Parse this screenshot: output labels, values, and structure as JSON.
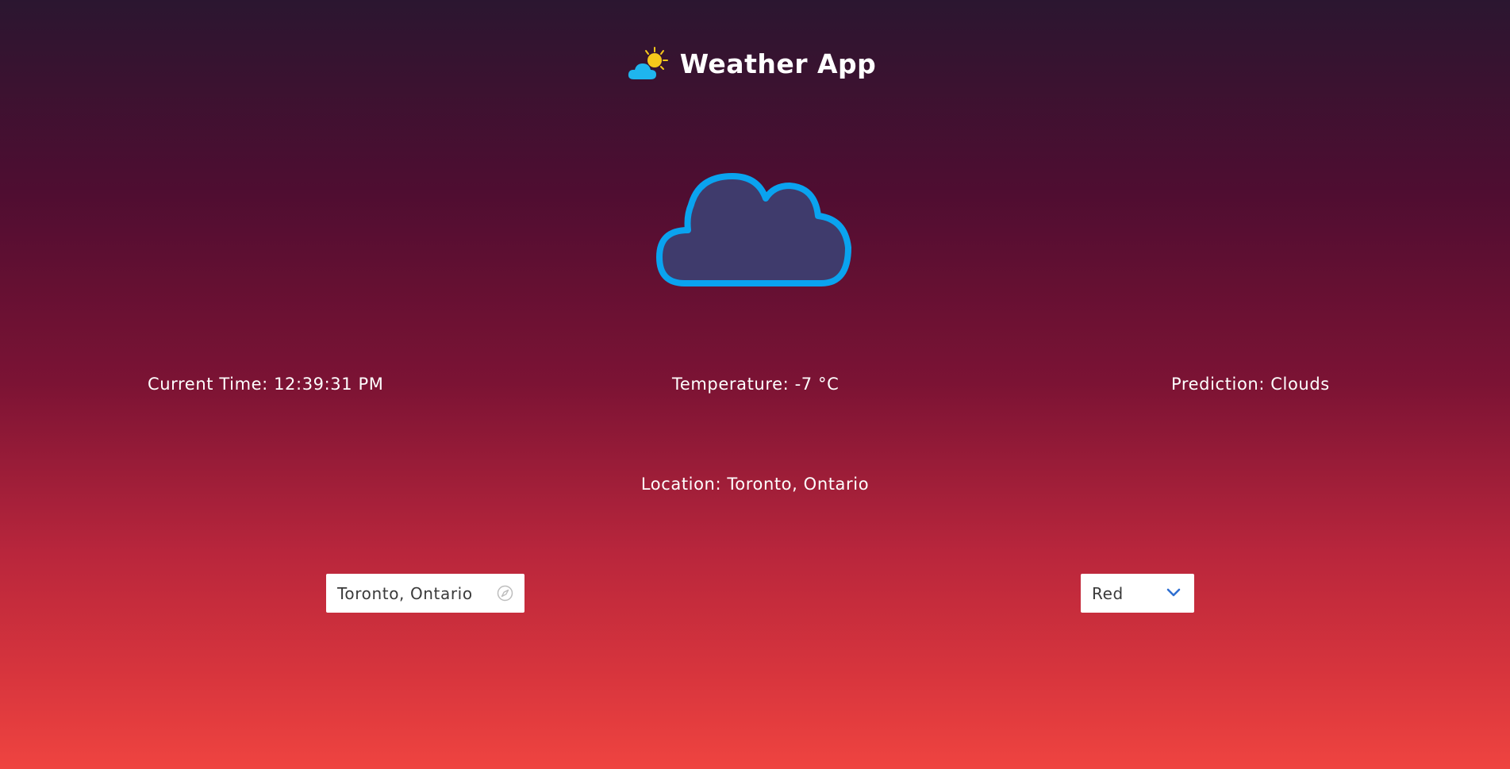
{
  "header": {
    "title": "Weather App",
    "logo_icon": "partly-cloudy-sun-icon"
  },
  "weather": {
    "icon": "cloud-icon",
    "current_time_text": "Current Time: 12:39:31 PM",
    "temperature_text": "Temperature: -7 °C",
    "prediction_text": "Prediction: Clouds",
    "location_text": "Location: Toronto, Ontario"
  },
  "controls": {
    "location_input_value": "Toronto, Ontario",
    "location_icon": "compass-icon",
    "theme_selected": "Red",
    "theme_icon": "chevron-down-icon"
  },
  "colors": {
    "cloud_stroke": "#0aa3ef",
    "cloud_fill": "#3f3b6c",
    "sun": "#f7c81b",
    "chevron": "#2f6fd1"
  }
}
